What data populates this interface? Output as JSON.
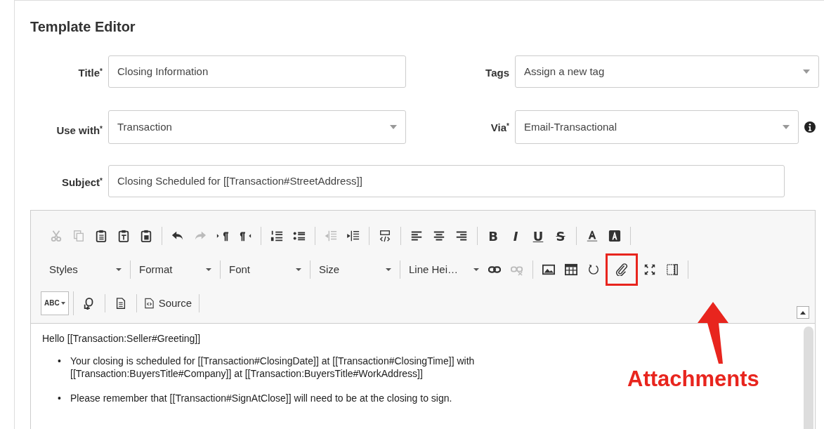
{
  "heading": "Template Editor",
  "fields": [
    {
      "label": "Title",
      "required_mark": "*",
      "kind": "input",
      "value": "Closing Information",
      "info": false
    },
    {
      "label": "Tags",
      "kind": "select",
      "value": "Assign a new tag",
      "info": false
    },
    {
      "label": "Use with",
      "required_mark": "*",
      "kind": "select",
      "value": "Transaction",
      "info": false
    },
    {
      "label": "Via",
      "required_mark": "*",
      "kind": "select",
      "value": "Email-Transactional",
      "info": true
    },
    {
      "label": "Subject",
      "required_mark": "*",
      "kind": "input",
      "value": "Closing Scheduled for [[Transaction#StreetAddress]]",
      "info": false
    }
  ],
  "toolbar": [
    [
      [
        {
          "kind": "icon",
          "disabled": true
        },
        {
          "kind": "icon",
          "disabled": true
        },
        {
          "kind": "icon",
          "disabled": false
        },
        {
          "kind": "icon",
          "disabled": false
        },
        {
          "kind": "icon",
          "disabled": false
        }
      ],
      [
        {
          "kind": "icon",
          "disabled": false
        },
        {
          "kind": "icon",
          "disabled": true
        },
        {
          "kind": "icon",
          "disabled": false
        },
        {
          "kind": "icon",
          "disabled": false
        }
      ],
      [
        {
          "kind": "icon",
          "disabled": false
        },
        {
          "kind": "icon",
          "disabled": false
        }
      ],
      [
        {
          "kind": "icon",
          "disabled": true
        },
        {
          "kind": "icon",
          "disabled": false
        }
      ],
      [
        {
          "kind": "icon",
          "disabled": false
        }
      ],
      [
        {
          "kind": "icon",
          "disabled": false
        },
        {
          "kind": "icon",
          "disabled": false
        },
        {
          "kind": "icon",
          "disabled": false
        }
      ],
      [
        {
          "kind": "glyph",
          "glyph": "B",
          "disabled": false
        },
        {
          "kind": "glyph",
          "glyph": "I",
          "disabled": false
        },
        {
          "kind": "glyph",
          "glyph": "U",
          "disabled": false
        },
        {
          "kind": "glyph",
          "glyph": "S",
          "disabled": false
        }
      ],
      [
        {
          "kind": "icon",
          "disabled": false
        },
        {
          "kind": "icon",
          "disabled": false
        }
      ]
    ],
    [
      [
        {
          "kind": "dropdown",
          "label": "Styles"
        }
      ],
      [
        {
          "kind": "dropdown",
          "label": "Format"
        }
      ],
      [
        {
          "kind": "dropdown",
          "label": "Font"
        }
      ],
      [
        {
          "kind": "dropdown",
          "label": "Size"
        }
      ],
      [
        {
          "kind": "dropdown",
          "label": "Line Hei…"
        },
        {
          "kind": "icon",
          "disabled": false
        },
        {
          "kind": "icon",
          "disabled": true
        }
      ],
      [
        {
          "kind": "icon",
          "disabled": false
        },
        {
          "kind": "icon",
          "disabled": false
        },
        {
          "kind": "icon",
          "disabled": false
        },
        {
          "kind": "icon",
          "disabled": false,
          "highlighted": true
        },
        {
          "kind": "icon",
          "disabled": false
        },
        {
          "kind": "icon",
          "disabled": false
        }
      ]
    ],
    [
      [
        {
          "kind": "spell",
          "glyph": "ABC"
        }
      ],
      [
        {
          "kind": "icon",
          "disabled": false
        }
      ],
      [
        {
          "kind": "icon",
          "disabled": false
        }
      ],
      [
        {
          "kind": "button",
          "label": "Source"
        }
      ]
    ]
  ],
  "body": {
    "greeting": "Hello [[Transaction:Seller#Greeting]]",
    "bullet_marker": "•",
    "bullets": [
      "Your closing is scheduled for [[Transaction#ClosingDate]] at [[Transaction#ClosingTime]]  with [[Transaction:BuyersTitle#Company]] at [[Transaction:BuyersTitle#WorkAddress]]",
      "Please remember that [[Transaction#SignAtClose]] will need to be at the closing to sign."
    ]
  },
  "annotation": "Attachments"
}
